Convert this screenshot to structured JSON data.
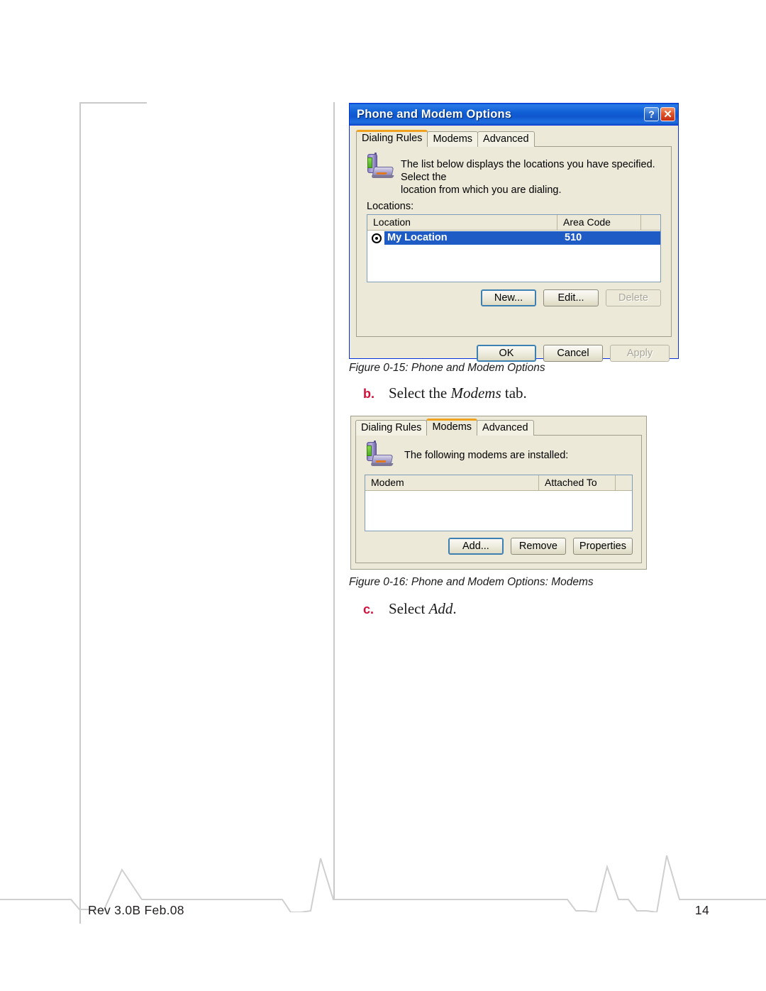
{
  "page": {
    "footer_rev": "Rev 3.0B  Feb.08",
    "page_number": "14"
  },
  "figure1": {
    "caption": "Figure 0-15:  Phone and Modem Options",
    "dialog": {
      "title": "Phone and Modem Options",
      "help_button": "?",
      "close_button": "✕",
      "tabs": [
        {
          "label": "Dialing Rules",
          "active": true
        },
        {
          "label": "Modems",
          "active": false
        },
        {
          "label": "Advanced",
          "active": false
        }
      ],
      "info_text_line1": "The list below displays the locations you have specified. Select the",
      "info_text_line2": "location from which you are dialing.",
      "locations_label": "Locations:",
      "columns": [
        "Location",
        "Area Code"
      ],
      "rows": [
        {
          "location": "My Location",
          "area_code": "510",
          "selected": true
        }
      ],
      "list_buttons": [
        {
          "label": "New...",
          "state": "focus"
        },
        {
          "label": "Edit...",
          "state": "normal"
        },
        {
          "label": "Delete",
          "state": "disabled"
        }
      ],
      "dialog_buttons": [
        {
          "label": "OK",
          "state": "focus"
        },
        {
          "label": "Cancel",
          "state": "normal"
        },
        {
          "label": "Apply",
          "state": "disabled"
        }
      ]
    }
  },
  "step_b": {
    "marker": "b.",
    "text_before": "Select the ",
    "emphasis": "Modems",
    "text_after": " tab."
  },
  "figure2": {
    "caption": "Figure 0-16:  Phone and Modem Options: Modems",
    "dialog": {
      "tabs": [
        {
          "label": "Dialing Rules",
          "active": false
        },
        {
          "label": "Modems",
          "active": true
        },
        {
          "label": "Advanced",
          "active": false
        }
      ],
      "info_text": "The following modems are  installed:",
      "columns": [
        "Modem",
        "Attached To"
      ],
      "rows": [],
      "buttons": [
        {
          "label": "Add...",
          "state": "focus"
        },
        {
          "label": "Remove",
          "state": "normal"
        },
        {
          "label": "Properties",
          "state": "normal"
        }
      ]
    }
  },
  "step_c": {
    "marker": "c.",
    "text_before": "Select ",
    "emphasis": "Add",
    "text_after": "."
  },
  "colors": {
    "title_bar": "#0f57cf",
    "dialog_face": "#ece9d8",
    "selection": "#1f5bc4",
    "active_tab_accent": "#f0a21e",
    "marker_red": "#d0103a",
    "rule_grey": "#c9c9c9"
  }
}
